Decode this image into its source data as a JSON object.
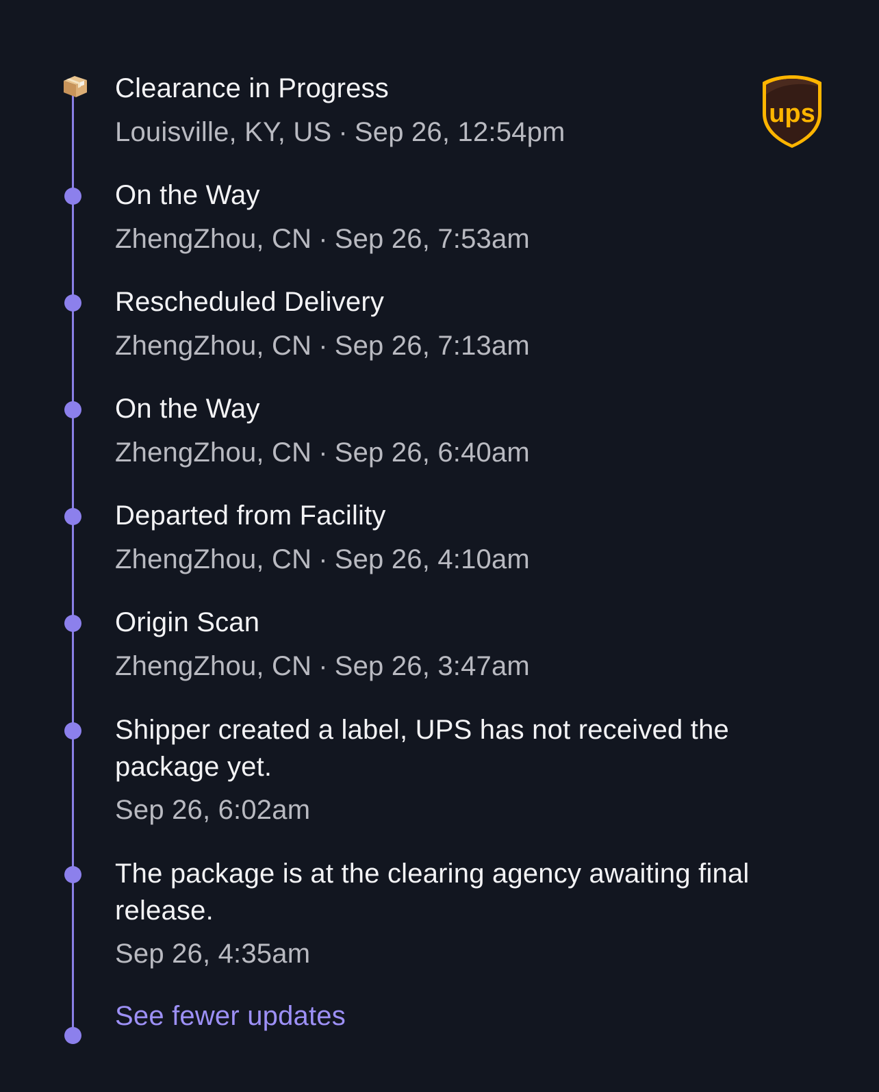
{
  "carrier": {
    "name": "UPS",
    "logo_text": "ups",
    "logo_colors": {
      "shield": "#351c15",
      "accent": "#ffb500"
    }
  },
  "accent_color": "#8c80ec",
  "events": [
    {
      "title": "Clearance in Progress",
      "location": "Louisville, KY, US",
      "separator": "·",
      "time": "Sep 26, 12:54pm",
      "icon": "package-icon"
    },
    {
      "title": "On the Way",
      "location": "ZhengZhou, CN",
      "separator": "·",
      "time": "Sep 26, 7:53am"
    },
    {
      "title": "Rescheduled Delivery",
      "location": "ZhengZhou, CN",
      "separator": "·",
      "time": "Sep 26, 7:13am"
    },
    {
      "title": "On the Way",
      "location": "ZhengZhou, CN",
      "separator": "·",
      "time": "Sep 26, 6:40am"
    },
    {
      "title": "Departed from Facility",
      "location": "ZhengZhou, CN",
      "separator": "·",
      "time": "Sep 26, 4:10am"
    },
    {
      "title": "Origin Scan",
      "location": "ZhengZhou, CN",
      "separator": "·",
      "time": "Sep 26, 3:47am"
    },
    {
      "title": "Shipper created a label, UPS has not received the package yet.",
      "time": "Sep 26, 6:02am"
    },
    {
      "title": "The package is at the clearing agency awaiting final release.",
      "time": "Sep 26, 4:35am"
    }
  ],
  "footer": {
    "see_fewer_label": "See fewer updates"
  }
}
